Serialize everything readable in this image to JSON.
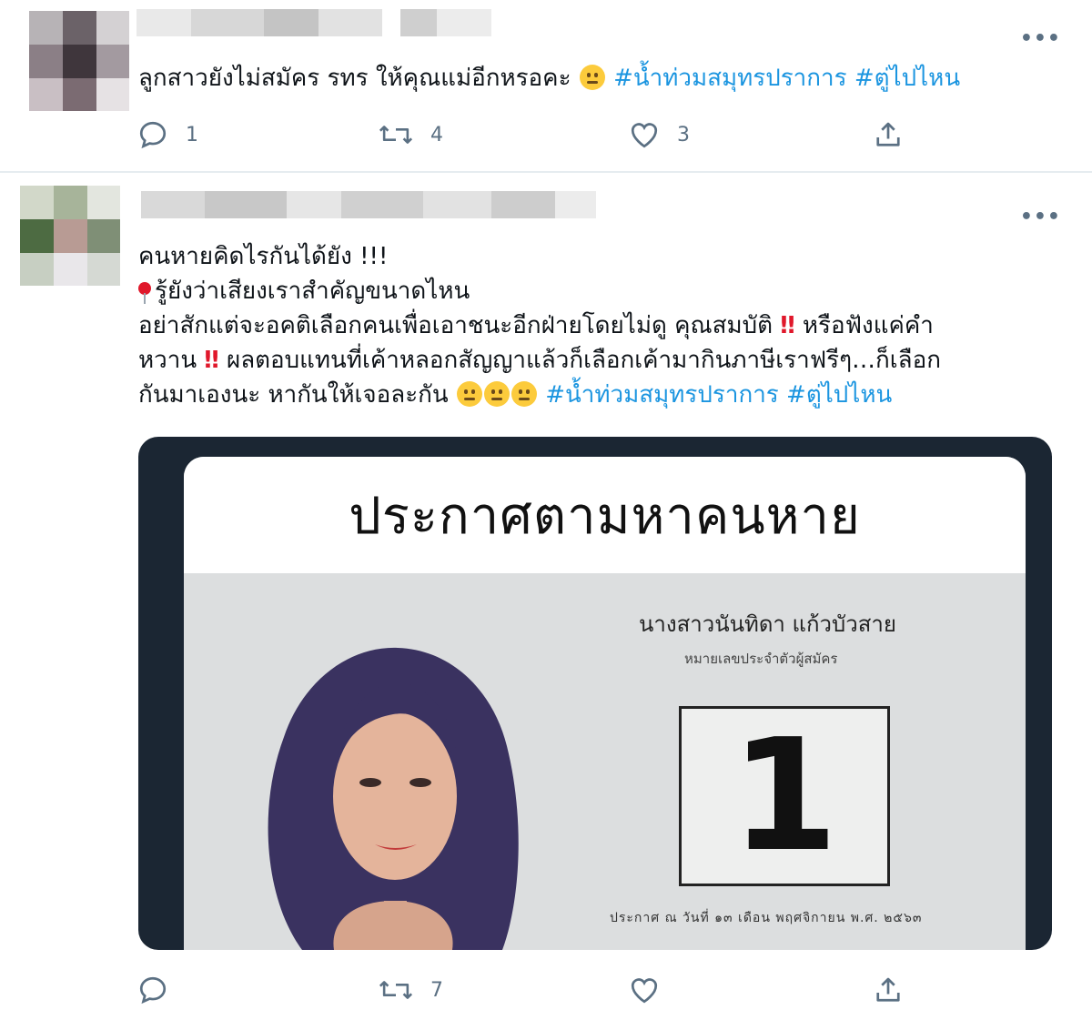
{
  "tweets": [
    {
      "text_before_emoji": "ลูกสาวยังไม่สมัคร รทร ให้คุณแม่อีกหรอคะ ",
      "hashtags": [
        "#น้ำท่วมสมุทรปราการ",
        "#ตู่ไปไหน"
      ],
      "counts": {
        "replies": "1",
        "retweets": "4",
        "likes": "3"
      }
    },
    {
      "lines": {
        "line1": "คนหายคิดไรกันได้ยัง !!!",
        "line2": "รู้ยังว่าเสียงเราสำคัญขนาดไหน",
        "line3a": "อย่าสักแต่จะอคติเลือกคนเพื่อเอาชนะอีกฝ่ายโดยไม่ดู คุณสมบัติ ",
        "line3b": " หรือฟังแค่คำ",
        "line4a": "หวาน ",
        "line4b": " ผลตอบแทนที่เค้าหลอกสัญญาแล้วก็เลือกเค้ามากินภาษีเราฟรีๆ…ก็เลือก",
        "line5": "กันมาเองนะ หากันให้เจอละกัน "
      },
      "bangbang": "‼",
      "hashtags": [
        "#น้ำท่วมสมุทรปราการ",
        "#ตู่ไปไหน"
      ],
      "counts": {
        "replies": "",
        "retweets": "7",
        "likes": ""
      },
      "poster": {
        "title": "ประกาศตามหาคนหาย",
        "candidate_name": "นางสาวนันทิดา  แก้วบัวสาย",
        "candidate_sub": "หมายเลขประจำตัวผู้สมัคร",
        "number": "1",
        "announce": "ประกาศ ณ วันที่ ๑๓ เดือน พฤศจิกายน พ.ศ. ๒๕๖๓"
      }
    }
  ],
  "more_label": "•••",
  "colors": {
    "hashtag": "#1b95e0",
    "icon": "#5b7083",
    "divider": "#e6ecf0"
  }
}
